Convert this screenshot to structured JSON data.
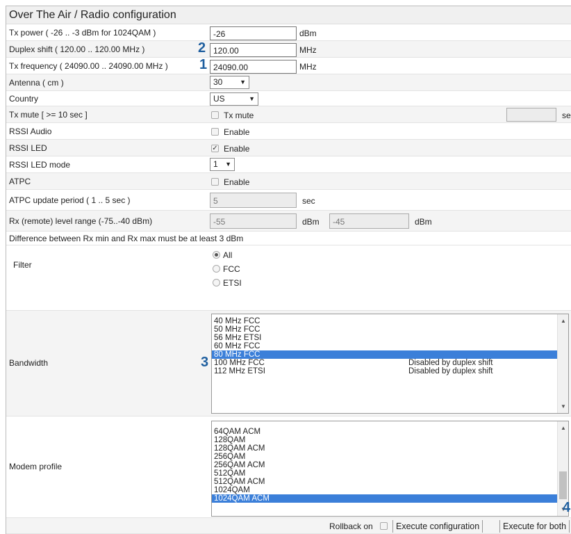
{
  "title": "Over The Air / Radio configuration",
  "tx_power": {
    "label": "Tx power ( -26 .. -3 dBm  for 1024QAM )",
    "value": "-26",
    "unit": "dBm"
  },
  "duplex_shift": {
    "label": "Duplex shift ( 120.00 ..  120.00  MHz )",
    "value": "120.00",
    "unit": "MHz",
    "callout": "2"
  },
  "tx_frequency": {
    "label": "Tx frequency ( 24090.00 .. 24090.00 MHz )",
    "value": "24090.00",
    "unit": "MHz",
    "callout": "1"
  },
  "antenna": {
    "label": "Antenna ( cm )",
    "value": "30"
  },
  "country": {
    "label": "Country",
    "value": "US"
  },
  "tx_mute": {
    "label": "Tx mute [ >= 10 sec ]",
    "checkbox_label": "Tx mute",
    "checked": false,
    "trailing_unit": "se"
  },
  "rssi_audio": {
    "label": "RSSI Audio",
    "checkbox_label": "Enable",
    "checked": false
  },
  "rssi_led": {
    "label": "RSSI LED",
    "checkbox_label": "Enable",
    "checked": true
  },
  "rssi_led_mode": {
    "label": "RSSI LED mode",
    "value": "1"
  },
  "atpc": {
    "label": "ATPC",
    "checkbox_label": "Enable",
    "checked": false
  },
  "atpc_period": {
    "label": "ATPC update period ( 1 .. 5 sec )",
    "value": "5",
    "unit": "sec"
  },
  "rx_range": {
    "label": "Rx (remote) level range (-75..-40 dBm)",
    "min_value": "-55",
    "min_unit": "dBm",
    "max_value": "-45",
    "max_unit": "dBm"
  },
  "rx_note": "Difference between Rx min and Rx max must be at least 3 dBm",
  "filter": {
    "label": "Filter",
    "options": [
      "All",
      "FCC",
      "ETSI"
    ],
    "selected": "All"
  },
  "bandwidth": {
    "label": "Bandwidth",
    "callout": "3",
    "items": [
      {
        "text": "40 MHz FCC",
        "note": ""
      },
      {
        "text": "50 MHz FCC",
        "note": ""
      },
      {
        "text": "56 MHz ETSI",
        "note": ""
      },
      {
        "text": "60 MHz FCC",
        "note": ""
      },
      {
        "text": "80 MHz FCC",
        "note": ""
      },
      {
        "text": "100 MHz FCC",
        "note": "Disabled by duplex shift"
      },
      {
        "text": "112 MHz ETSI",
        "note": "Disabled by duplex shift"
      }
    ],
    "selected": "80 MHz FCC"
  },
  "modem_profile": {
    "label": "Modem profile",
    "callout": "4",
    "items": [
      "64QAM ACM",
      "128QAM",
      "128QAM ACM",
      "256QAM",
      "256QAM ACM",
      "512QAM",
      "512QAM ACM",
      "1024QAM",
      "1024QAM ACM"
    ],
    "selected": "1024QAM ACM"
  },
  "footer": {
    "rollback_label": "Rollback on",
    "rollback_checked": false,
    "execute_config_label": "Execute configuration",
    "execute_both_label": "Execute for both"
  },
  "colors": {
    "selection": "#3b7fd9",
    "callout": "#1f5f9f"
  }
}
